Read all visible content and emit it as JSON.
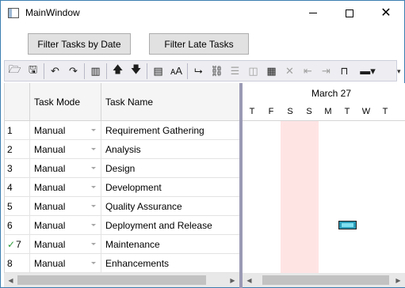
{
  "window": {
    "title": "MainWindow"
  },
  "buttons": {
    "filter_by_date": "Filter Tasks by Date",
    "filter_late": "Filter Late Tasks"
  },
  "toolbar": {
    "items": [
      "open-folder-icon",
      "save-icon",
      "undo-icon",
      "redo-icon",
      "columns-icon",
      "move-up-icon",
      "move-down-icon",
      "show-details-icon",
      "font-icon",
      "indent-link-icon",
      "link-icon",
      "split-icon",
      "unlink-icon",
      "calendar-icon",
      "delete-icon",
      "outdent-icon",
      "indent-icon",
      "milestone-icon",
      "bar-style-dropdown-icon"
    ]
  },
  "grid": {
    "headers": {
      "mode": "Task Mode",
      "name": "Task Name"
    },
    "rows": [
      {
        "id": "1",
        "mode": "Manual",
        "name": "Requirement Gathering",
        "checked": false
      },
      {
        "id": "2",
        "mode": "Manual",
        "name": "Analysis",
        "checked": false
      },
      {
        "id": "3",
        "mode": "Manual",
        "name": "Design",
        "checked": false
      },
      {
        "id": "4",
        "mode": "Manual",
        "name": "Development",
        "checked": false
      },
      {
        "id": "5",
        "mode": "Manual",
        "name": "Quality Assurance",
        "checked": false
      },
      {
        "id": "6",
        "mode": "Manual",
        "name": "Deployment and Release",
        "checked": false
      },
      {
        "id": "7",
        "mode": "Manual",
        "name": "Maintenance",
        "checked": true
      },
      {
        "id": "8",
        "mode": "Manual",
        "name": "Enhancements",
        "checked": false
      }
    ]
  },
  "chart": {
    "month": "March 27",
    "days": [
      "T",
      "F",
      "S",
      "S",
      "M",
      "T",
      "W",
      "T"
    ],
    "weekend_color": "#ffe4e4",
    "bar_color": "#2a9bb8"
  }
}
